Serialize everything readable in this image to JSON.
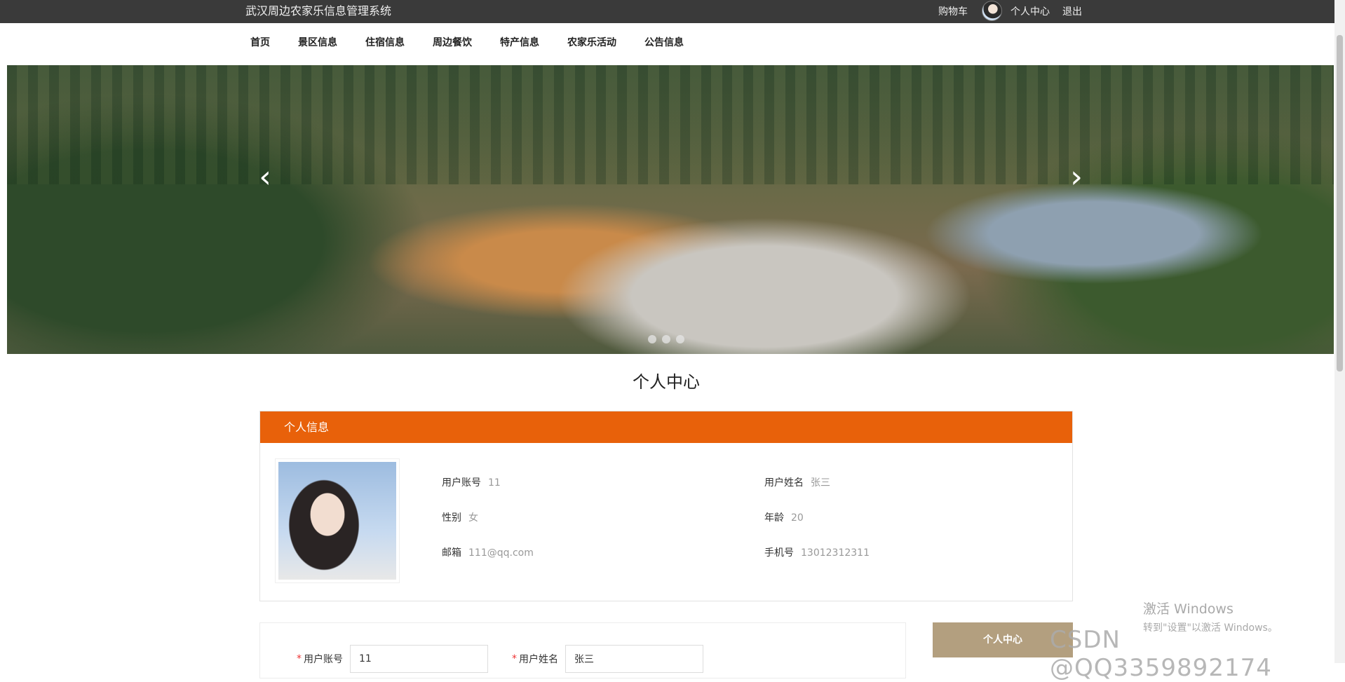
{
  "topbar": {
    "title": "武汉周边农家乐信息管理系统",
    "cart": "购物车",
    "personal_center": "个人中心",
    "logout": "退出"
  },
  "nav": {
    "items": [
      "首页",
      "景区信息",
      "住宿信息",
      "周边餐饮",
      "特产信息",
      "农家乐活动",
      "公告信息"
    ]
  },
  "banner": {
    "prev": "‹",
    "next": "›",
    "slide_count": 3
  },
  "page_title": "个人中心",
  "profile_card": {
    "header": "个人信息",
    "fields": {
      "account": {
        "label": "用户账号",
        "value": "11"
      },
      "name": {
        "label": "用户姓名",
        "value": "张三"
      },
      "gender": {
        "label": "性别",
        "value": "女"
      },
      "age": {
        "label": "年龄",
        "value": "20"
      },
      "email": {
        "label": "邮箱",
        "value": "111@qq.com"
      },
      "phone": {
        "label": "手机号",
        "value": "13012312311"
      }
    }
  },
  "form": {
    "account": {
      "label": "用户账号",
      "value": "11"
    },
    "name": {
      "label": "用户姓名",
      "value": "张三"
    }
  },
  "side_menu": {
    "personal_center": "个人中心"
  },
  "watermark": {
    "activate_title": "激活 Windows",
    "activate_hint": "转到\"设置\"以激活 Windows。",
    "csdn": "CSDN @QQ3359892174"
  }
}
